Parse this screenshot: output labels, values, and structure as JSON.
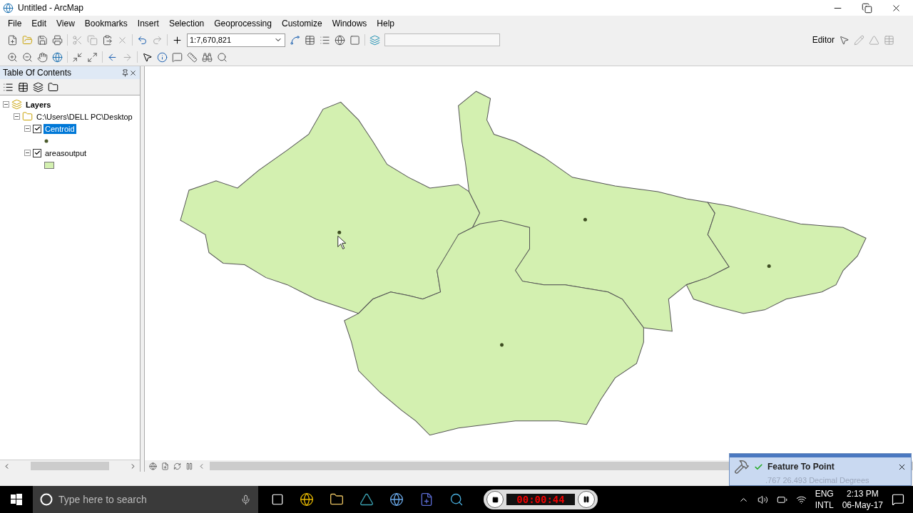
{
  "window": {
    "title": "Untitled - ArcMap"
  },
  "menu": [
    "File",
    "Edit",
    "View",
    "Bookmarks",
    "Insert",
    "Selection",
    "Geoprocessing",
    "Customize",
    "Windows",
    "Help"
  ],
  "toolbar": {
    "scale": "1:7,670,821",
    "editor": "Editor"
  },
  "toc": {
    "title": "Table Of Contents",
    "tree": [
      {
        "label": "Layers",
        "kind": "frame",
        "expanded": true,
        "children": [
          {
            "label": "C:\\Users\\DELL PC\\Desktop",
            "kind": "folder",
            "expanded": true,
            "children": [
              {
                "label": "Centroid",
                "kind": "point",
                "checked": true,
                "selected": true,
                "expanded": true
              },
              {
                "label": "areasoutput",
                "kind": "polygon",
                "checked": true,
                "selected": false,
                "expanded": true
              }
            ]
          }
        ]
      }
    ]
  },
  "notification": {
    "title": "Feature To Point",
    "status": ".767  26.493 Decimal Degrees"
  },
  "taskbar": {
    "search_placeholder": "Type here to search",
    "recorder_time": "00:00:44",
    "language": [
      "ENG",
      "INTL"
    ],
    "time": "2:13 PM",
    "date": "06-May-17"
  }
}
